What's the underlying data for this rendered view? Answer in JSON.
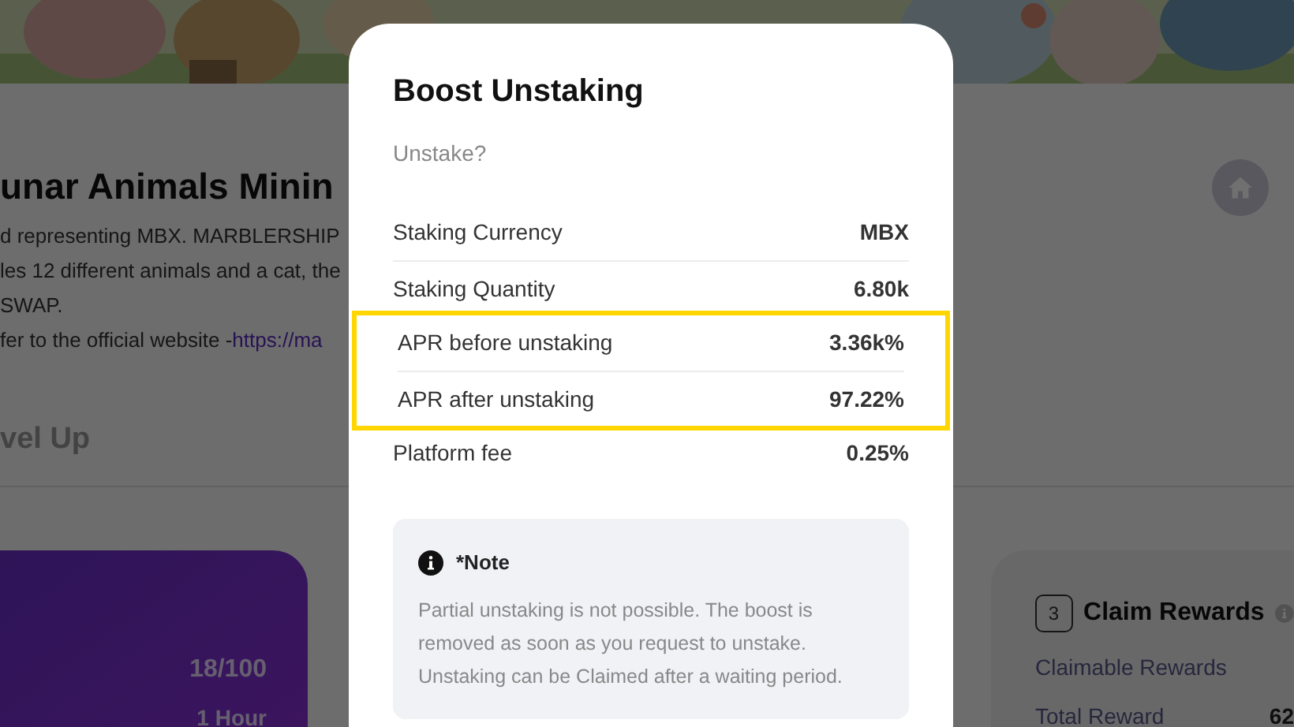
{
  "page": {
    "title": "unar Animals Minin",
    "description": [
      "d representing MBX. MARBLERSHIP",
      "les 12 different animals and a cat, the",
      "SWAP."
    ],
    "website": {
      "text": "fer to the official website - ",
      "link": "https://ma"
    },
    "section_title": "vel Up",
    "level_card": {
      "count": "18/100",
      "duration": "1 Hour"
    },
    "claim_card": {
      "step": "3",
      "title": "Claim Rewards",
      "rows": [
        {
          "label": "Claimable Rewards"
        },
        {
          "label": "Total Reward",
          "value": "62"
        }
      ]
    }
  },
  "modal": {
    "title": "Boost Unstaking",
    "subtitle": "Unstake?",
    "rows": [
      {
        "label": "Staking Currency",
        "value": "MBX",
        "highlighted": false
      },
      {
        "label": "Staking Quantity",
        "value": "6.80k",
        "highlighted": false
      },
      {
        "label": "APR before unstaking",
        "value": "3.36k%",
        "highlighted": true
      },
      {
        "label": "APR after unstaking",
        "value": "97.22%",
        "highlighted": true
      },
      {
        "label": "Platform fee",
        "value": "0.25%",
        "highlighted": false
      }
    ],
    "note": {
      "title": "*Note",
      "text": "Partial unstaking is not possible. The boost is removed as soon as you request to unstake. Unstaking can be Claimed after a waiting period."
    }
  }
}
